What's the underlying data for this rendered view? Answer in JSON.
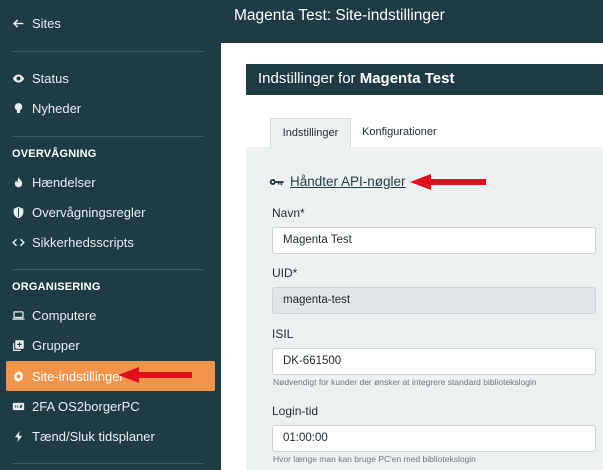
{
  "sidebar": {
    "back_label": "Sites",
    "items_top": [
      {
        "label": "Status",
        "icon": "eye-icon"
      },
      {
        "label": "Nyheder",
        "icon": "lightbulb-icon"
      }
    ],
    "section_monitoring": {
      "heading": "OVERVÅGNING",
      "items": [
        {
          "label": "Hændelser",
          "icon": "fire-icon"
        },
        {
          "label": "Overvågningsregler",
          "icon": "shield-icon"
        },
        {
          "label": "Sikkerhedsscripts",
          "icon": "code-icon"
        }
      ]
    },
    "section_org": {
      "heading": "ORGANISERING",
      "items": [
        {
          "label": "Computere",
          "icon": "laptop-icon"
        },
        {
          "label": "Grupper",
          "icon": "plus-square-icon"
        },
        {
          "label": "Site-indstillinger",
          "icon": "gear-icon",
          "active": true
        },
        {
          "label": "2FA OS2borgerPC",
          "icon": "keypad-icon"
        },
        {
          "label": "Tænd/Sluk tidsplaner",
          "icon": "bolt-icon"
        }
      ]
    }
  },
  "header": {
    "title": "Magenta Test: Site-indstillinger"
  },
  "panel": {
    "title_prefix": "Indstillinger for",
    "site_name": "Magenta Test"
  },
  "tabs": [
    {
      "label": "Indstillinger",
      "active": true
    },
    {
      "label": "Konfigurationer",
      "active": false
    }
  ],
  "form": {
    "api_link": "Håndter API-nøgler",
    "fields": [
      {
        "label": "Navn*",
        "value": "Magenta Test",
        "disabled": false,
        "help": ""
      },
      {
        "label": "UID*",
        "value": "magenta-test",
        "disabled": true,
        "help": ""
      },
      {
        "label": "ISIL",
        "value": "DK-661500",
        "disabled": false,
        "help": "Nødvendigt for kunder der ønsker at integrere standard bibliotekslogin"
      },
      {
        "label": "Login-tid",
        "value": "01:00:00",
        "disabled": false,
        "help": "Hvor længe man kan bruge PC'en med bibliotekslogin"
      }
    ]
  },
  "colors": {
    "sidebar_bg": "#1f3b44",
    "active_item_bg": "#f2954a",
    "annotation_arrow": "#e0101a"
  }
}
